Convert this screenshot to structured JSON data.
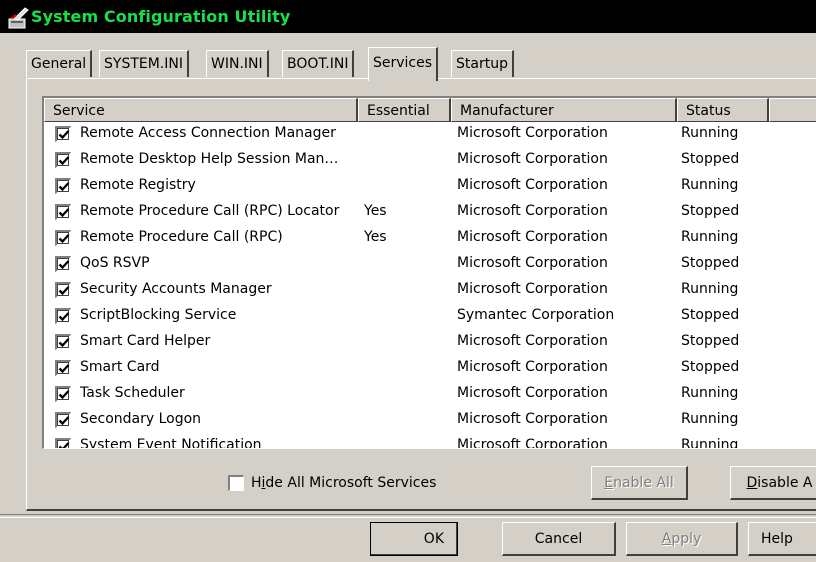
{
  "window": {
    "title": "System Configuration Utility",
    "app_icon": "msconfig-icon"
  },
  "tabs": [
    {
      "label": "General"
    },
    {
      "label": "SYSTEM.INI"
    },
    {
      "label": "WIN.INI"
    },
    {
      "label": "BOOT.INI"
    },
    {
      "label": "Services",
      "active": true
    },
    {
      "label": "Startup"
    }
  ],
  "services_list": {
    "columns": [
      "Service",
      "Essential",
      "Manufacturer",
      "Status"
    ],
    "rows": [
      {
        "checked": true,
        "service": "Remote Access Connection Manager",
        "essential": "",
        "manufacturer": "Microsoft Corporation",
        "status": "Running"
      },
      {
        "checked": true,
        "service": "Remote Desktop Help Session Man…",
        "essential": "",
        "manufacturer": "Microsoft Corporation",
        "status": "Stopped"
      },
      {
        "checked": true,
        "service": "Remote Registry",
        "essential": "",
        "manufacturer": "Microsoft Corporation",
        "status": "Running"
      },
      {
        "checked": true,
        "service": "Remote Procedure Call (RPC) Locator",
        "essential": "Yes",
        "manufacturer": "Microsoft Corporation",
        "status": "Stopped"
      },
      {
        "checked": true,
        "service": "Remote Procedure Call (RPC)",
        "essential": "Yes",
        "manufacturer": "Microsoft Corporation",
        "status": "Running"
      },
      {
        "checked": true,
        "service": "QoS RSVP",
        "essential": "",
        "manufacturer": "Microsoft Corporation",
        "status": "Stopped"
      },
      {
        "checked": true,
        "service": "Security Accounts Manager",
        "essential": "",
        "manufacturer": "Microsoft Corporation",
        "status": "Running"
      },
      {
        "checked": true,
        "service": "ScriptBlocking Service",
        "essential": "",
        "manufacturer": "Symantec Corporation",
        "status": "Stopped"
      },
      {
        "checked": true,
        "service": "Smart Card Helper",
        "essential": "",
        "manufacturer": "Microsoft Corporation",
        "status": "Stopped"
      },
      {
        "checked": true,
        "service": "Smart Card",
        "essential": "",
        "manufacturer": "Microsoft Corporation",
        "status": "Stopped"
      },
      {
        "checked": true,
        "service": "Task Scheduler",
        "essential": "",
        "manufacturer": "Microsoft Corporation",
        "status": "Running"
      },
      {
        "checked": true,
        "service": "Secondary Logon",
        "essential": "",
        "manufacturer": "Microsoft Corporation",
        "status": "Running"
      },
      {
        "checked": true,
        "service": "System Event Notification",
        "essential": "",
        "manufacturer": "Microsoft Corporation",
        "status": "Running"
      }
    ]
  },
  "hide_ms_services": {
    "label": "Hide All Microsoft Services",
    "checked": false
  },
  "buttons": {
    "enable_all": "Enable All",
    "disable_all": "Disable A",
    "ok": "OK",
    "cancel": "Cancel",
    "apply": "Apply",
    "help": "Help"
  },
  "colors": {
    "title_text": "#18e04a",
    "title_bar": "#000000",
    "face": "#d4d0c8"
  }
}
